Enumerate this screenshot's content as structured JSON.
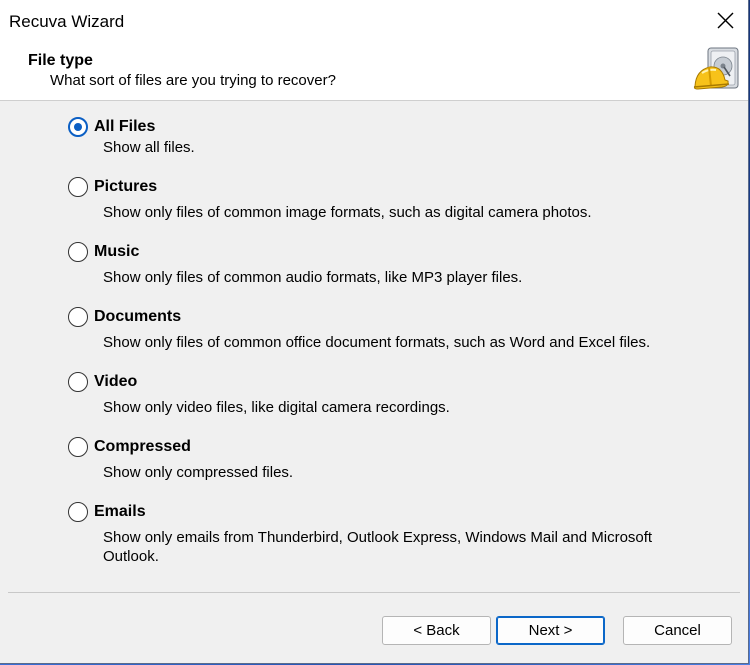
{
  "window": {
    "title": "Recuva Wizard"
  },
  "header": {
    "title": "File type",
    "subtitle": "What sort of files are you trying to recover?",
    "logo_icon": "recuva-hardhat-drive-icon"
  },
  "options": [
    {
      "label": "All Files",
      "description": "Show all files.",
      "checked": true
    },
    {
      "label": "Pictures",
      "description": "Show only files of common image formats, such as digital camera photos.",
      "checked": false
    },
    {
      "label": "Music",
      "description": "Show only files of common audio formats, like MP3 player files.",
      "checked": false
    },
    {
      "label": "Documents",
      "description": "Show only files of common office document formats, such as Word and Excel files.",
      "checked": false
    },
    {
      "label": "Video",
      "description": "Show only video files, like digital camera recordings.",
      "checked": false
    },
    {
      "label": "Compressed",
      "description": "Show only compressed files.",
      "checked": false
    },
    {
      "label": "Emails",
      "description": "Show only emails from Thunderbird, Outlook Express, Windows Mail and Microsoft Outlook.",
      "checked": false
    }
  ],
  "buttons": {
    "back": "< Back",
    "next": "Next >",
    "cancel": "Cancel"
  },
  "colors": {
    "accent": "#0b5fc4",
    "window_bg": "#f0f0f0",
    "header_bg": "#ffffff"
  }
}
